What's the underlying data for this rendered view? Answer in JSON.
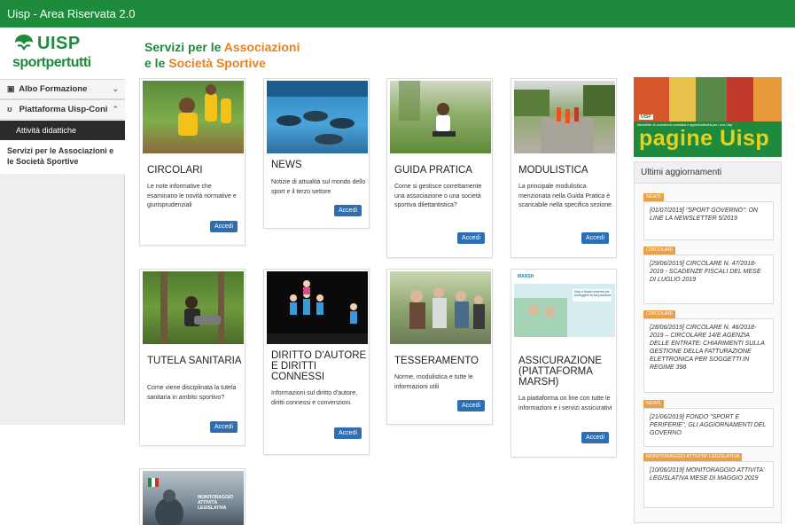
{
  "window": {
    "title": "Uisp - Area Riservata 2.0"
  },
  "logo": {
    "brand": "UISP",
    "tagline": "sportpertutti"
  },
  "sidebar": {
    "items": [
      {
        "label": "Albo Formazione",
        "icon": "book-icon"
      },
      {
        "label": "Piattaforma Uisp-Coni",
        "icon": "link-icon"
      }
    ],
    "sub_item": "Attività didattiche",
    "plain_item": "Servizi per le Associazioni e le Società Sportive"
  },
  "page": {
    "heading_line1_a": "Servizi per le ",
    "heading_line1_b": "Associazioni",
    "heading_line2_a": "e le ",
    "heading_line2_b": "Società Sportive"
  },
  "cards": [
    {
      "title": "CIRCOLARI",
      "desc": "Le note informative che esaminano le novità normative e giurisprudenziali",
      "button": "Accedi"
    },
    {
      "title": "NEWS",
      "desc": "Notizie di attualità sul mondo dello sport e il terzo settore",
      "button": "Accedi"
    },
    {
      "title": "GUIDA PRATICA",
      "desc": "Come si gestisce correttamente una associazione o una società sportiva dilettantistica?",
      "button": "Accedi"
    },
    {
      "title": "MODULISTICA",
      "desc": "La principale modulistica menzionata nella Guida Pratica è scaricabile nella specifica sezione.",
      "button": "Accedi"
    },
    {
      "title": "TUTELA SANITARIA",
      "desc": "Come viene disciplinata la tutela sanitaria in ambito sportivo?",
      "button": "Accedi"
    },
    {
      "title": "DIRITTO D'AUTORE E DIRITTI CONNESSI",
      "desc": "Informazioni sul diritto d'autore, diritti connessi e convenzioni.",
      "button": "Accedi"
    },
    {
      "title": "TESSERAMENTO",
      "desc": "Norme, modulistica e tutte le informazioni utili",
      "button": "Accedi"
    },
    {
      "title": "ASSICURAZIONE (PIATTAFORMA MARSH)",
      "desc": "La piattaforma on line con tutte le informazioni e i servizi assicurativi",
      "button": "Accedi"
    },
    {
      "title": "",
      "desc": "",
      "button": ""
    }
  ],
  "images": {
    "monitoraggio_caption": "MONITORAGGIO ATTIVITÀ LEGISLATIVA",
    "marsh_logo": "MARSH",
    "marsh_text": "Uisp e Marsh insieme per proteggere la tua passione"
  },
  "banner": {
    "text": "pagine Uisp",
    "strap": "Newsletter di consulenza normativa e approfondimenti per i soci Uisp",
    "brand": "UISP"
  },
  "updates": {
    "heading": "Ultimi aggiornamenti",
    "items": [
      {
        "tag": "NEWS",
        "text": "[01/07/2019] \"SPORT GOVERNO\": ON LINE LA NEWSLETTER 5/2019"
      },
      {
        "tag": "CIRCOLARI",
        "text": "[29/06/2019] CIRCOLARE N. 47/2018-2019 - SCADENZE FISCALI DEL MESE DI LUGLIO 2019"
      },
      {
        "tag": "CIRCOLARI",
        "text": "[28/06/2019] CIRCOLARE N. 46/2018-2019 – CIRCOLARE 14/E AGENZIA DELLE ENTRATE: CHIARIMENTI SULLA GESTIONE DELLA FATTURAZIONE ELETTRONICA PER SOGGETTI IN REGIME 398"
      },
      {
        "tag": "NEWS",
        "text": "[21/06/2019] FONDO \"SPORT E PERIFERIE\", GLI AGGIORNAMENTI DEL GOVERNO"
      },
      {
        "tag": "MONITORAGGIO ATTIVITA' LEGISLATIVA",
        "text": "[10/06/2019] MONITORAGGIO ATTIVITA' LEGISLATIVA MESE DI MAGGIO 2019"
      }
    ]
  },
  "colors": {
    "brand_green": "#1e8b3c",
    "accent_orange": "#e8821e",
    "button_blue": "#2d6fb2",
    "tag_orange": "#e8a04a"
  }
}
